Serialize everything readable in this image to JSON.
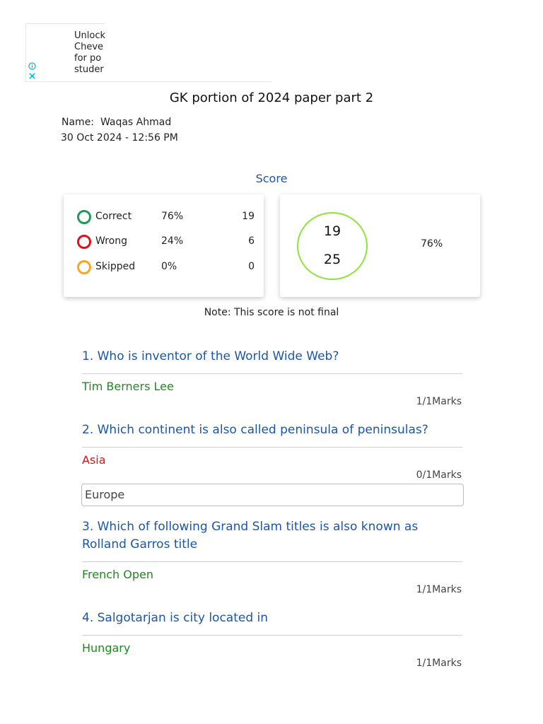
{
  "ad": {
    "lines": [
      "Unlock",
      "Cheve",
      "for po",
      "studer"
    ],
    "info_icon": "info-icon",
    "close_icon": "close-icon"
  },
  "quiz": {
    "title": "GK portion of 2024 paper part 2",
    "name_label": "Name:",
    "name_value": "Waqas Ahmad",
    "datetime": "30 Oct 2024 - 12:56 PM"
  },
  "score": {
    "label": "Score",
    "rows": [
      {
        "label": "Correct",
        "percent": "76%",
        "count": "19",
        "color": "#1e9a5a"
      },
      {
        "label": "Wrong",
        "percent": "24%",
        "count": "6",
        "color": "#e0101a"
      },
      {
        "label": "Skipped",
        "percent": "0%",
        "count": "0",
        "color": "#f5a623"
      }
    ],
    "ring_top": "19",
    "ring_bottom": "25",
    "ring_color": "#8ee43a",
    "overall_percent": "76%",
    "note": "Note: This score is not final"
  },
  "questions": [
    {
      "text": "1. Who is inventor of the World Wide Web?",
      "answer": "Tim Berners Lee",
      "status": "correct",
      "marks": "1/1Marks"
    },
    {
      "text": "2. Which continent is also called peninsula of peninsulas?",
      "answer": "Asia",
      "status": "wrong",
      "marks": "0/1Marks",
      "correct_answer": "Europe"
    },
    {
      "text": "3. Which of following Grand Slam titles is also known as Rolland Garros title",
      "answer": "French Open",
      "status": "correct",
      "marks": "1/1Marks"
    },
    {
      "text": "4. Salgotarjan is city located in",
      "answer": "Hungary",
      "status": "correct",
      "marks": "1/1Marks"
    }
  ],
  "colors": {
    "accent": "#1b56a8",
    "correct": "#1e8a1e",
    "wrong": "#e01010"
  }
}
